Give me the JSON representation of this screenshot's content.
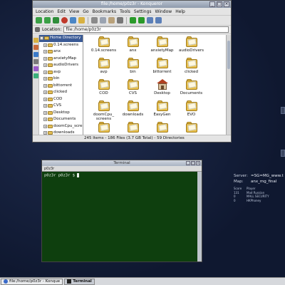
{
  "konqueror": {
    "title": "file:/home/p0z3r - Konqueror",
    "menu": [
      "Location",
      "Edit",
      "View",
      "Go",
      "Bookmarks",
      "Tools",
      "Settings",
      "Window",
      "Help"
    ],
    "location_label": "Location:",
    "location_value": "file:/home/p0z3r",
    "tree": {
      "root": "Home Directory",
      "items": [
        "0.14.screens",
        "anx",
        "anxietyMap",
        "audioDrivers",
        "avp",
        "bin",
        "bittorrent",
        "clicked",
        "COD",
        "CVS",
        "Desktop",
        "Documents",
        "doomCpu_scre",
        "downloads",
        "EasyGen",
        "EVO",
        "evolution"
      ]
    },
    "icons": [
      {
        "label": "0.14.screens",
        "kind": "folder"
      },
      {
        "label": "anx",
        "kind": "folder"
      },
      {
        "label": "anxietyMap",
        "kind": "folder"
      },
      {
        "label": "audioDrivers",
        "kind": "folder"
      },
      {
        "label": "avp",
        "kind": "folder"
      },
      {
        "label": "bin",
        "kind": "folder"
      },
      {
        "label": "bittorrent",
        "kind": "folder"
      },
      {
        "label": "clicked",
        "kind": "folder"
      },
      {
        "label": "COD",
        "kind": "folder"
      },
      {
        "label": "CVS",
        "kind": "folder"
      },
      {
        "label": "Desktop",
        "kind": "home"
      },
      {
        "label": "Documents",
        "kind": "folder"
      },
      {
        "label": "doomCpu_ screens",
        "kind": "folder"
      },
      {
        "label": "downloads",
        "kind": "folder"
      },
      {
        "label": "EasyGen",
        "kind": "folder"
      },
      {
        "label": "EVO",
        "kind": "folder"
      },
      {
        "label": "",
        "kind": "folder"
      },
      {
        "label": "",
        "kind": "folder"
      },
      {
        "label": "",
        "kind": "folder"
      },
      {
        "label": "",
        "kind": "folder"
      }
    ],
    "status": "245 Items - 186 Files (3.7 GB Total) - 59 Directories"
  },
  "terminal": {
    "title": "Terminal",
    "tab_label": "p0z3r",
    "prompt": "p0z3r   p0z3r  $ "
  },
  "server": {
    "server_label": "Server:",
    "server_value": "=SG=MG_www.t",
    "map_label": "Map:",
    "map_value": "anx_mg_final",
    "score_header": [
      "Score",
      "Player"
    ],
    "scores": [
      [
        "131",
        "Mad Russian"
      ],
      [
        "0",
        "MALL SECURITY"
      ],
      [
        "0",
        "HKPhoney"
      ]
    ]
  },
  "taskbar": {
    "items": [
      {
        "label": "file:/home/p0z3r - Konque",
        "active": false
      },
      {
        "label": "Terminal",
        "active": true
      }
    ]
  }
}
